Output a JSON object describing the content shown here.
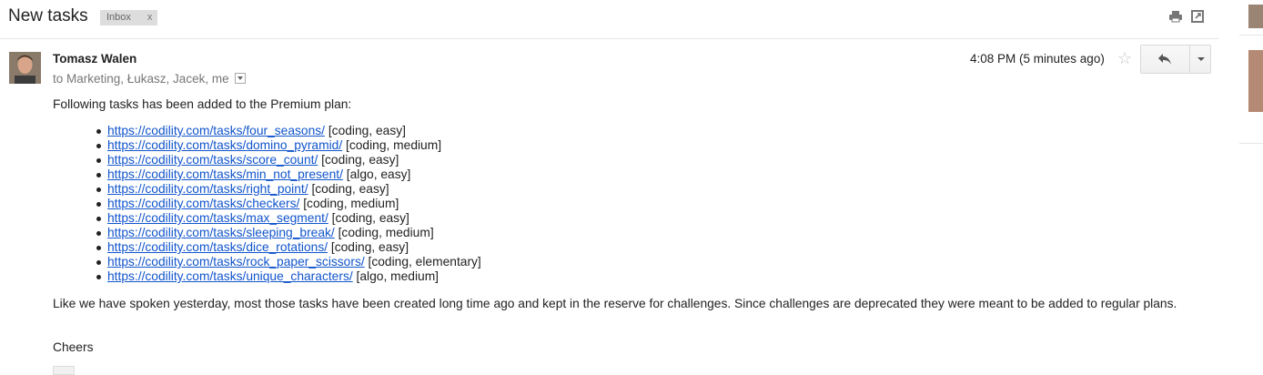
{
  "header": {
    "subject": "New tasks",
    "label": "Inbox",
    "label_remove": "x"
  },
  "message": {
    "sender": "Tomasz Walen",
    "recipients": "to Marketing, Łukasz, Jacek, me",
    "timestamp": "4:08 PM (5 minutes ago)",
    "intro": "Following tasks has been added to the Premium plan:",
    "tasks": [
      {
        "url": "https://codility.com/tasks/four_seasons/",
        "tags": " [coding, easy]"
      },
      {
        "url": "https://codility.com/tasks/domino_pyramid/",
        "tags": "[coding, medium]"
      },
      {
        "url": "https://codility.com/tasks/score_count/",
        "tags": "[coding, easy]"
      },
      {
        "url": "https://codility.com/tasks/min_not_present/",
        "tags": "[algo, easy]"
      },
      {
        "url": "https://codility.com/tasks/right_point/",
        "tags": "[coding, easy]"
      },
      {
        "url": "https://codility.com/tasks/checkers/",
        "tags": "[coding, medium]"
      },
      {
        "url": "https://codility.com/tasks/max_segment/",
        "tags": "[coding, easy]"
      },
      {
        "url": "https://codility.com/tasks/sleeping_break/",
        "tags": "[coding, medium]"
      },
      {
        "url": "https://codility.com/tasks/dice_rotations/",
        "tags": "[coding, easy]"
      },
      {
        "url": "https://codility.com/tasks/rock_paper_scissors/",
        "tags": "[coding, elementary]"
      },
      {
        "url": "https://codility.com/tasks/unique_characters/",
        "tags": "[algo, medium]"
      }
    ],
    "paragraph": "Like we have spoken yesterday, most those tasks have been created long time ago and kept in the reserve for challenges. Since challenges are deprecated they were meant to be added to regular plans.",
    "signoff": "Cheers"
  },
  "icons": [
    "print-icon",
    "new-window-icon",
    "star-icon",
    "reply-icon",
    "chevron-down-icon"
  ],
  "colors": {
    "link": "#1155cc",
    "label_bg": "#dddddd"
  }
}
